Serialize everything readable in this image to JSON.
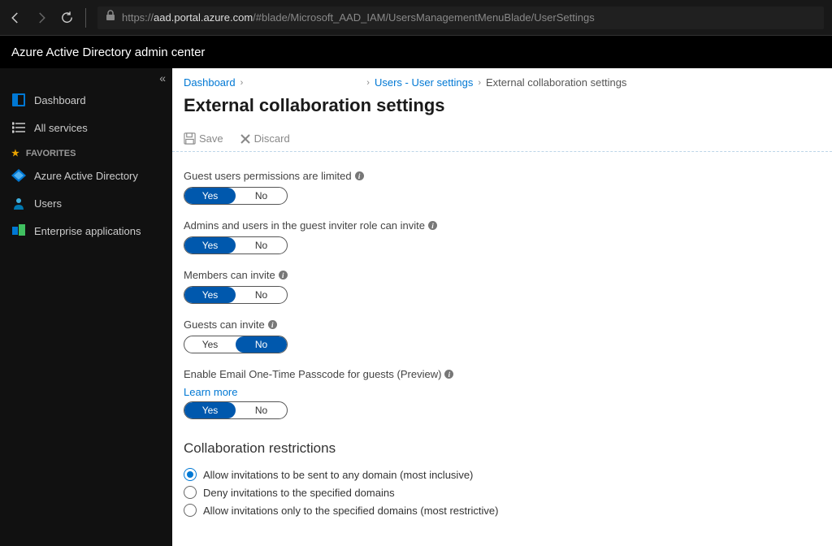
{
  "browser": {
    "url_prefix": "https://",
    "url_domain": "aad.portal.azure.com",
    "url_path": "/#blade/Microsoft_AAD_IAM/UsersManagementMenuBlade/UserSettings"
  },
  "header": {
    "title": "Azure Active Directory admin center"
  },
  "sidebar": {
    "dashboard": "Dashboard",
    "all_services": "All services",
    "favorites_label": "FAVORITES",
    "aad": "Azure Active Directory",
    "users": "Users",
    "enterprise_apps": "Enterprise applications"
  },
  "breadcrumb": {
    "dashboard": "Dashboard",
    "users": "Users - User settings",
    "current": "External collaboration settings"
  },
  "page": {
    "title": "External collaboration settings"
  },
  "toolbar": {
    "save": "Save",
    "discard": "Discard"
  },
  "toggles": {
    "yes": "Yes",
    "no": "No",
    "guest_perms": {
      "label": "Guest users permissions are limited",
      "value": "Yes"
    },
    "admins_invite": {
      "label": "Admins and users in the guest inviter role can invite",
      "value": "Yes"
    },
    "members_invite": {
      "label": "Members can invite",
      "value": "Yes"
    },
    "guests_invite": {
      "label": "Guests can invite",
      "value": "No"
    },
    "email_otp": {
      "label": "Enable Email One-Time Passcode for guests (Preview)",
      "learn_more": "Learn more",
      "value": "Yes"
    }
  },
  "collab": {
    "heading": "Collaboration restrictions",
    "opt1": "Allow invitations to be sent to any domain (most inclusive)",
    "opt2": "Deny invitations to the specified domains",
    "opt3": "Allow invitations only to the specified domains (most restrictive)",
    "selected": 0
  }
}
